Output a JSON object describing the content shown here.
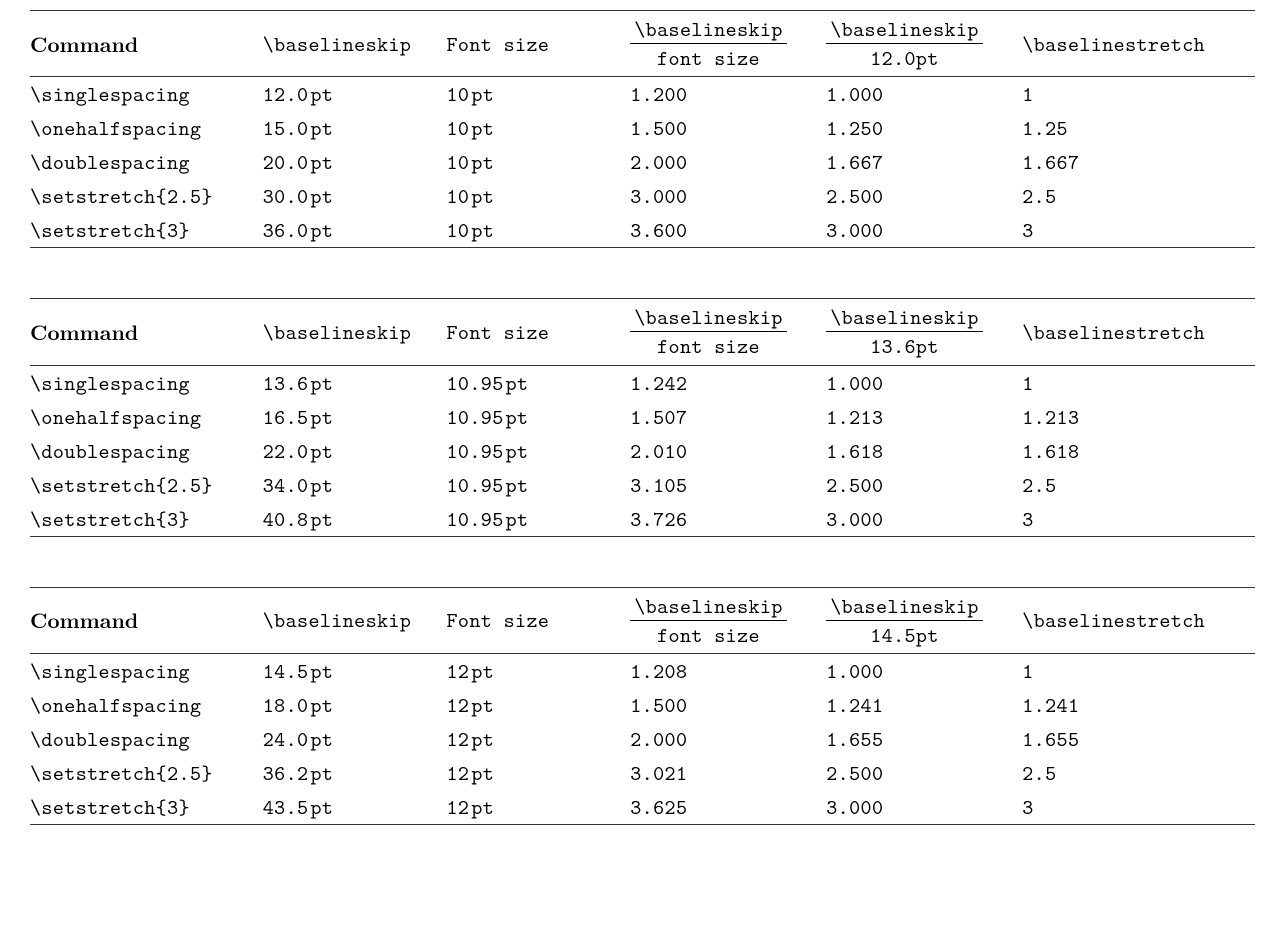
{
  "headers": {
    "command": "Command",
    "baselineskip": "\\baselineskip",
    "fontsize": "Font size",
    "frac_fontsize_num": "\\baselineskip",
    "frac_fontsize_den": "font size",
    "frac_default_num": "\\baselineskip",
    "baselinestretch": "\\baselinestretch"
  },
  "tables": [
    {
      "default_baselineskip": "12.0pt",
      "rows": [
        {
          "cmd": "\\singlespacing",
          "bskip": "12.0pt",
          "fsize": "10pt",
          "r1": "1.200",
          "r2": "1.000",
          "stretch": "1"
        },
        {
          "cmd": "\\onehalfspacing",
          "bskip": "15.0pt",
          "fsize": "10pt",
          "r1": "1.500",
          "r2": "1.250",
          "stretch": "1.25"
        },
        {
          "cmd": "\\doublespacing",
          "bskip": "20.0pt",
          "fsize": "10pt",
          "r1": "2.000",
          "r2": "1.667",
          "stretch": "1.667"
        },
        {
          "cmd": "\\setstretch{2.5}",
          "bskip": "30.0pt",
          "fsize": "10pt",
          "r1": "3.000",
          "r2": "2.500",
          "stretch": "2.5"
        },
        {
          "cmd": "\\setstretch{3}",
          "bskip": "36.0pt",
          "fsize": "10pt",
          "r1": "3.600",
          "r2": "3.000",
          "stretch": "3"
        }
      ]
    },
    {
      "default_baselineskip": "13.6pt",
      "rows": [
        {
          "cmd": "\\singlespacing",
          "bskip": "13.6pt",
          "fsize": "10.95pt",
          "r1": "1.242",
          "r2": "1.000",
          "stretch": "1"
        },
        {
          "cmd": "\\onehalfspacing",
          "bskip": "16.5pt",
          "fsize": "10.95pt",
          "r1": "1.507",
          "r2": "1.213",
          "stretch": "1.213"
        },
        {
          "cmd": "\\doublespacing",
          "bskip": "22.0pt",
          "fsize": "10.95pt",
          "r1": "2.010",
          "r2": "1.618",
          "stretch": "1.618"
        },
        {
          "cmd": "\\setstretch{2.5}",
          "bskip": "34.0pt",
          "fsize": "10.95pt",
          "r1": "3.105",
          "r2": "2.500",
          "stretch": "2.5"
        },
        {
          "cmd": "\\setstretch{3}",
          "bskip": "40.8pt",
          "fsize": "10.95pt",
          "r1": "3.726",
          "r2": "3.000",
          "stretch": "3"
        }
      ]
    },
    {
      "default_baselineskip": "14.5pt",
      "rows": [
        {
          "cmd": "\\singlespacing",
          "bskip": "14.5pt",
          "fsize": "12pt",
          "r1": "1.208",
          "r2": "1.000",
          "stretch": "1"
        },
        {
          "cmd": "\\onehalfspacing",
          "bskip": "18.0pt",
          "fsize": "12pt",
          "r1": "1.500",
          "r2": "1.241",
          "stretch": "1.241"
        },
        {
          "cmd": "\\doublespacing",
          "bskip": "24.0pt",
          "fsize": "12pt",
          "r1": "2.000",
          "r2": "1.655",
          "stretch": "1.655"
        },
        {
          "cmd": "\\setstretch{2.5}",
          "bskip": "36.2pt",
          "fsize": "12pt",
          "r1": "3.021",
          "r2": "2.500",
          "stretch": "2.5"
        },
        {
          "cmd": "\\setstretch{3}",
          "bskip": "43.5pt",
          "fsize": "12pt",
          "r1": "3.625",
          "r2": "3.000",
          "stretch": "3"
        }
      ]
    }
  ]
}
